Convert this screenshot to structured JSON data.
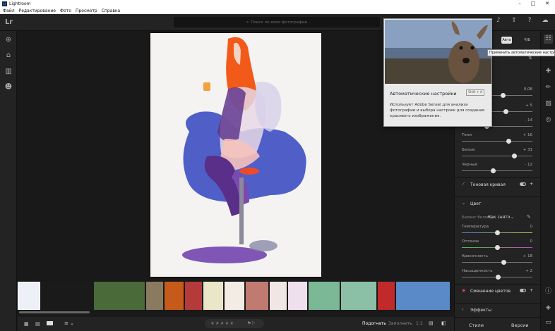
{
  "window": {
    "title": "Lightroom",
    "app_icon_text": "Lr"
  },
  "menu": [
    "Файл",
    "Редактирование",
    "Фото",
    "Просмотр",
    "Справка"
  ],
  "topbar": {
    "logo": "Lr",
    "search_placeholder": "Поиск по всем фотографии"
  },
  "popup": {
    "title": "Автоматические настройки",
    "shortcut": "Shift + A",
    "body": "Использует Adobe Sensei для анализа фотографии и выбора настроек для создания красивого изображения."
  },
  "tooltip": "Применить автоматические настройки",
  "panel": {
    "auto_button": "Авто",
    "bw_button": "Ч/Б",
    "light_sliders": [
      {
        "label": "",
        "value": "0,08",
        "pos": 0.58
      },
      {
        "label": "",
        "value": "+ 5",
        "pos": 0.62
      },
      {
        "label": "",
        "value": "- 14",
        "pos": 0.35
      },
      {
        "label": "",
        "value": "",
        "pos": 0.3
      },
      {
        "label": "Тени",
        "value": "+ 16",
        "pos": 0.66
      },
      {
        "label": "Белые",
        "value": "+ 31",
        "pos": 0.74
      },
      {
        "label": "Черные",
        "value": "- 12",
        "pos": 0.44
      }
    ],
    "tone_curve": "Тоновая кривая",
    "color_section": "Цвет",
    "wb_label": "Баланс белого",
    "wb_value": "Как снято",
    "color_sliders": [
      {
        "label": "Температура",
        "value": "0",
        "pos": 0.5
      },
      {
        "label": "Оттенок",
        "value": "0",
        "pos": 0.5
      },
      {
        "label": "Красочность",
        "value": "+ 18",
        "pos": 0.59
      },
      {
        "label": "Насыщенность",
        "value": "+ 2",
        "pos": 0.51
      }
    ],
    "color_mix": "Смешение цветов",
    "effects": "Эффекты",
    "styles_btn": "Стили",
    "versions_btn": "Версии"
  },
  "bottombar": {
    "stars": "★★★★★",
    "fit": "Подогнать",
    "fill": "Заполнить",
    "ratio": "1:1"
  },
  "colors": {
    "accent": "#ffffff",
    "panel_bg": "#232323",
    "canvas_bg": "#191919"
  }
}
